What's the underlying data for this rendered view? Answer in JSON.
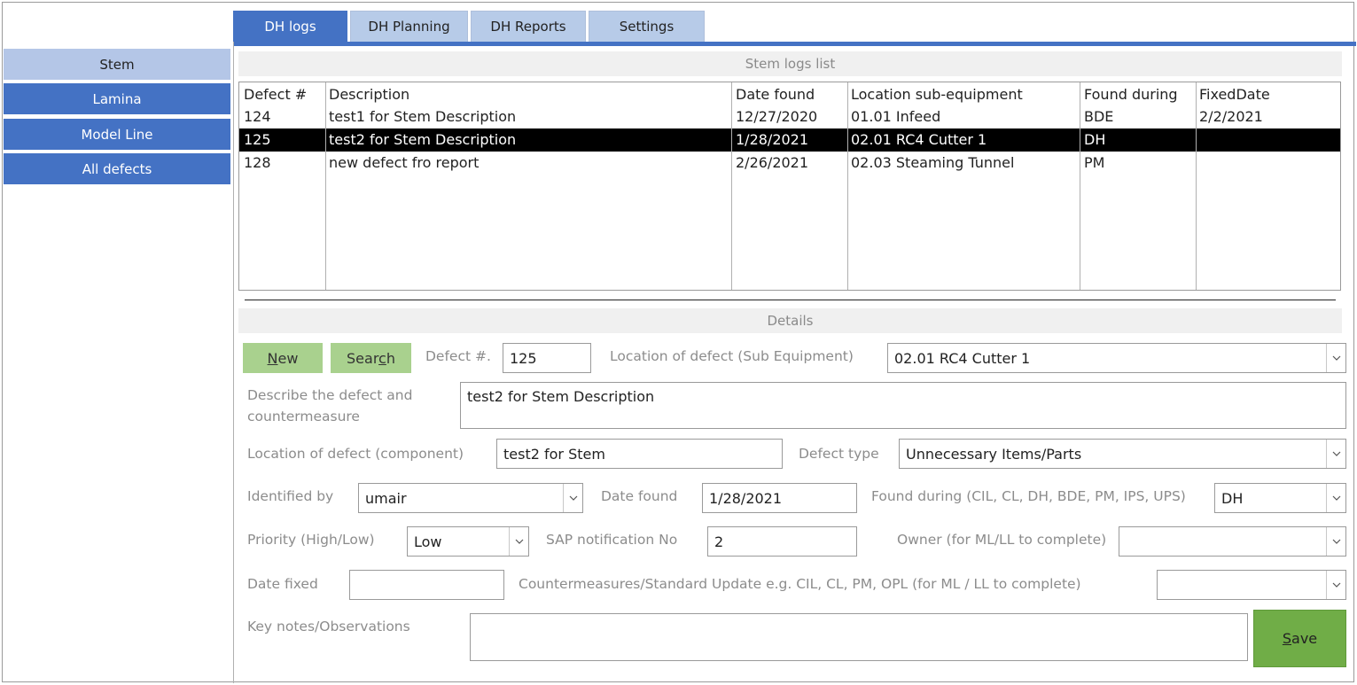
{
  "tabs": [
    {
      "label": "DH logs",
      "active": true
    },
    {
      "label": "DH Planning",
      "active": false
    },
    {
      "label": "DH Reports",
      "active": false
    },
    {
      "label": "Settings",
      "active": false
    }
  ],
  "sidebar": {
    "items": [
      {
        "label": "Stem",
        "selected": true
      },
      {
        "label": "Lamina",
        "selected": false
      },
      {
        "label": "Model Line",
        "selected": false
      },
      {
        "label": "All defects",
        "selected": false
      }
    ]
  },
  "list": {
    "title": "Stem logs list",
    "columns": [
      "Defect #",
      "Description",
      "Date found",
      "Location sub-equipment",
      "Found during",
      "FixedDate"
    ],
    "rows": [
      {
        "cells": [
          "124",
          "test1 for Stem Description",
          "12/27/2020",
          "01.01 Infeed",
          "BDE",
          "2/2/2021"
        ],
        "selected": false
      },
      {
        "cells": [
          "125",
          "test2 for Stem  Description",
          "1/28/2021",
          "02.01 RC4 Cutter 1",
          "DH",
          ""
        ],
        "selected": true
      },
      {
        "cells": [
          "128",
          "new defect fro report",
          "2/26/2021",
          "02.03 Steaming Tunnel",
          "PM",
          ""
        ],
        "selected": false
      }
    ]
  },
  "details": {
    "title": "Details",
    "new_btn": {
      "pre": "",
      "key": "N",
      "post": "ew"
    },
    "search_btn": {
      "pre": "Sear",
      "key": "c",
      "post": "h"
    },
    "defect_no_label": "Defect #.",
    "defect_no_value": "125",
    "loc_sub_label": "Location of defect (Sub Equipment)",
    "loc_sub_value": "02.01 RC4 Cutter 1",
    "describe_label_1": "Describe the defect and",
    "describe_label_2": "countermeasure",
    "describe_value": "test2 for Stem  Description",
    "loc_comp_label": "Location of defect (component)",
    "loc_comp_value": "test2 for Stem",
    "defect_type_label": "Defect type",
    "defect_type_value": "Unnecessary Items/Parts",
    "identified_label": "Identified by",
    "identified_value": "umair",
    "date_found_label": "Date found",
    "date_found_value": "1/28/2021",
    "found_during_label": "Found during (CIL, CL, DH, BDE, PM, IPS, UPS)",
    "found_during_value": "DH",
    "priority_label": "Priority (High/Low)",
    "priority_value": "Low",
    "sap_label": "SAP notification No",
    "sap_value": "2",
    "owner_label": "Owner (for ML/LL to complete)",
    "owner_value": "",
    "date_fixed_label": "Date fixed",
    "date_fixed_value": "",
    "countermeasures_label": "Countermeasures/Standard Update e.g. CIL, CL, PM, OPL (for ML / LL to complete)",
    "countermeasures_value": "",
    "notes_label": "Key notes/Observations",
    "notes_value": "",
    "save_btn": {
      "pre": "",
      "key": "S",
      "post": "ave"
    }
  },
  "colors": {
    "accent": "#4472c4",
    "accent_light": "#b4c6e7",
    "button_green": "#a9d18e",
    "save_green": "#70ad47"
  }
}
